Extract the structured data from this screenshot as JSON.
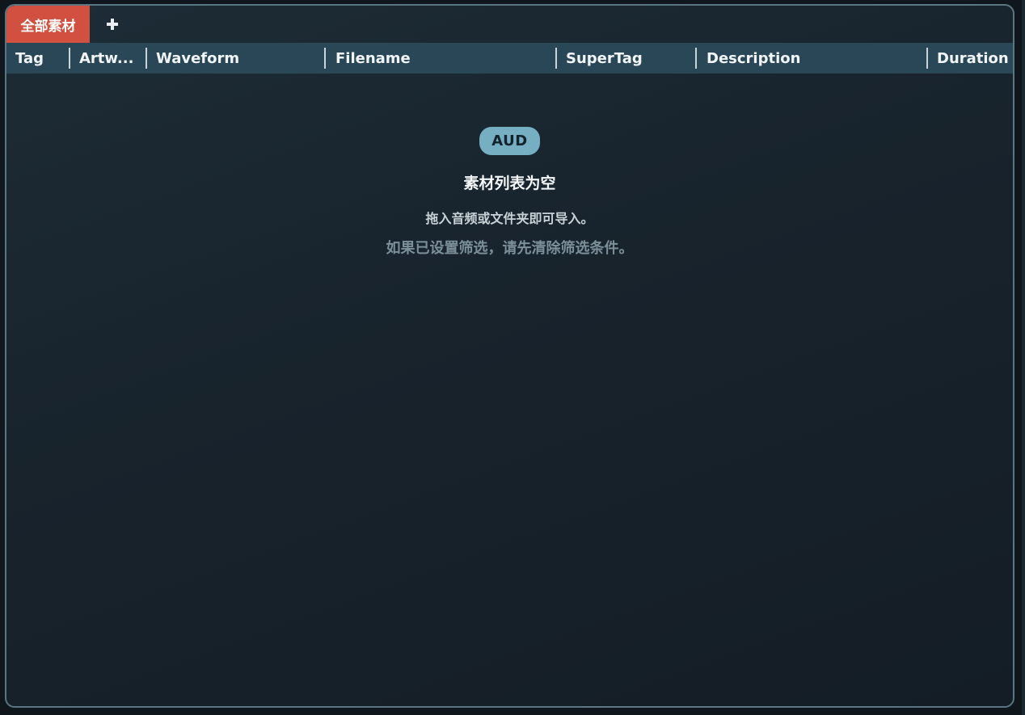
{
  "tabs": {
    "active_label": "全部素材",
    "add_icon": "plus-icon"
  },
  "columns": [
    {
      "label": "Tag"
    },
    {
      "label": "Artw..."
    },
    {
      "label": "Waveform"
    },
    {
      "label": "Filename"
    },
    {
      "label": "SuperTag"
    },
    {
      "label": "Description"
    },
    {
      "label": "Duration"
    }
  ],
  "empty_state": {
    "badge": "AUD",
    "title": "素材列表为空",
    "line1": "拖入音频或文件夹即可导入。",
    "line2": "如果已设置筛选，请先清除筛选条件。"
  },
  "colors": {
    "active_tab": "#d2503f",
    "header_bg": "#2a4757",
    "badge_bg": "#76afc2",
    "panel_border": "#5a7684"
  }
}
